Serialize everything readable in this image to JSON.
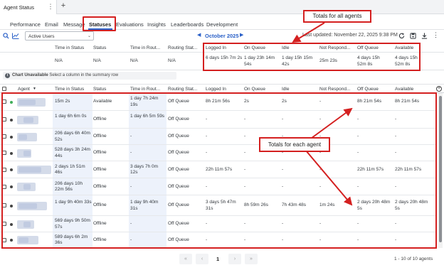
{
  "window": {
    "tab_title": "Agent Status",
    "menu_glyph": "⋮",
    "add_tab_glyph": "+"
  },
  "nav": {
    "tabs": [
      {
        "label": "Performance"
      },
      {
        "label": "Email"
      },
      {
        "label": "Message"
      },
      {
        "label": "Statuses",
        "active": true
      },
      {
        "label": "Evaluations"
      },
      {
        "label": "Insights"
      },
      {
        "label": "Leaderboards"
      },
      {
        "label": "Development"
      }
    ]
  },
  "toolbar": {
    "filter_value": "Active Users",
    "month": "October 2025",
    "last_updated": "Last updated: November 22, 2025 9:38 PM",
    "icons": [
      "search-icon",
      "chart-icon",
      "refresh-icon",
      "save-icon",
      "download-icon",
      "more-icon"
    ]
  },
  "summary": {
    "columns": [
      "Time in Status",
      "Status",
      "Time in Rout...",
      "Routing Stat...",
      "Logged In",
      "On Queue",
      "Idle",
      "Not Respond...",
      "Off Queue",
      "Available"
    ],
    "values": [
      "N/A",
      "N/A",
      "N/A",
      "N/A",
      "6 days 15h 7m 2s",
      "1 day 23h 14m 54s",
      "1 day 15h 15m 42s",
      "25m 23s",
      "4 days 15h 52m 8s",
      "4 days 15h 52m 8s"
    ]
  },
  "chart_note": {
    "strong": "Chart Unavailable",
    "text": "Select a column in the summary row"
  },
  "agents_table": {
    "columns": [
      "Agent",
      "Time in Status",
      "Status",
      "Time in Rout...",
      "Routing Stat...",
      "Logged In",
      "On Queue",
      "Idle",
      "Not Respond...",
      "Off Queue",
      "Available"
    ],
    "sort_glyph": "▼",
    "rows": [
      {
        "presence": "available",
        "time_in_status": "15m 2s",
        "status": "Available",
        "time_in_routing": "1 day 7h 24m 19s",
        "routing_status": "Off Queue",
        "logged_in": "8h 21m 56s",
        "on_queue": "2s",
        "idle": "2s",
        "not_responding": "-",
        "off_queue": "8h 21m 54s",
        "available": "8h 21m 54s"
      },
      {
        "presence": "offline",
        "time_in_status": "1 day 6h 6m 0s",
        "status": "Offline",
        "time_in_routing": "1 day 6h 5m 59s",
        "routing_status": "Off Queue",
        "logged_in": "-",
        "on_queue": "-",
        "idle": "-",
        "not_responding": "-",
        "off_queue": "-",
        "available": "-"
      },
      {
        "presence": "offline",
        "time_in_status": "206 days 6h 40m 52s",
        "status": "Offline",
        "time_in_routing": "-",
        "routing_status": "Off Queue",
        "logged_in": "-",
        "on_queue": "-",
        "idle": "-",
        "not_responding": "-",
        "off_queue": "-",
        "available": "-"
      },
      {
        "presence": "offline",
        "time_in_status": "528 days 3h 24m 44s",
        "status": "Offline",
        "time_in_routing": "-",
        "routing_status": "Off Queue",
        "logged_in": "-",
        "on_queue": "-",
        "idle": "-",
        "not_responding": "-",
        "off_queue": "-",
        "available": "-"
      },
      {
        "presence": "offline",
        "time_in_status": "2 days 1h 51m 46s",
        "status": "Offline",
        "time_in_routing": "3 days 7h 0m 12s",
        "routing_status": "Off Queue",
        "logged_in": "22h 11m 57s",
        "on_queue": "-",
        "idle": "-",
        "not_responding": "-",
        "off_queue": "22h 11m 57s",
        "available": "22h 11m 57s"
      },
      {
        "presence": "offline",
        "time_in_status": "206 days 10h 22m 56s",
        "status": "Offline",
        "time_in_routing": "-",
        "routing_status": "Off Queue",
        "logged_in": "-",
        "on_queue": "-",
        "idle": "-",
        "not_responding": "-",
        "off_queue": "-",
        "available": "-"
      },
      {
        "presence": "offline",
        "time_in_status": "1 day 9h 40m 33s",
        "status": "Offline",
        "time_in_routing": "1 day 9h 40m 31s",
        "routing_status": "Off Queue",
        "logged_in": "3 days 5h 47m 31s",
        "on_queue": "8h 59m 26s",
        "idle": "7h 43m 48s",
        "not_responding": "1m 24s",
        "off_queue": "2 days 20h 48m 5s",
        "available": "2 days 20h 48m 5s"
      },
      {
        "presence": "offline",
        "time_in_status": "569 days 9h 50m 57s",
        "status": "Offline",
        "time_in_routing": "-",
        "routing_status": "Off Queue",
        "logged_in": "-",
        "on_queue": "-",
        "idle": "-",
        "not_responding": "-",
        "off_queue": "-",
        "available": "-"
      },
      {
        "presence": "offline",
        "time_in_status": "589 days 6h 2m 36s",
        "status": "Offline",
        "time_in_routing": "-",
        "routing_status": "Off Queue",
        "logged_in": "-",
        "on_queue": "-",
        "idle": "-",
        "not_responding": "-",
        "off_queue": "-",
        "available": "-"
      }
    ]
  },
  "pagination": {
    "first": "«",
    "prev": "‹",
    "current": "1",
    "next": "›",
    "last": "»",
    "summary": "1 - 10 of 10 agents"
  },
  "annotations": {
    "totals_all": "Totals for all agents",
    "totals_each": "Totals for each agent",
    "color": "#d42020"
  }
}
